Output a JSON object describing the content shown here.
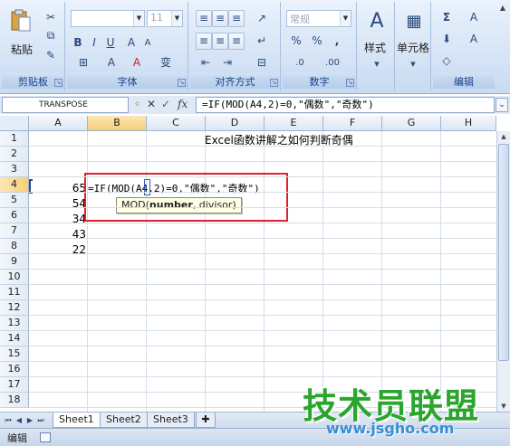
{
  "ribbon": {
    "clipboard": {
      "paste_label": "粘贴",
      "group_label": "剪贴板"
    },
    "font": {
      "font_name": "",
      "font_size": "11",
      "bold": "B",
      "italic": "I",
      "underline": "U",
      "font_color": "A",
      "fill_color": "A",
      "phonetic": "变",
      "grow_font": "A",
      "shrink_font": "A",
      "group_label": "字体"
    },
    "alignment": {
      "group_label": "对齐方式"
    },
    "number": {
      "format": "常规",
      "currency": "%",
      "percent": "%",
      "comma": ",",
      "increase_decimal": ".0",
      "decrease_decimal": ".00",
      "group_label": "数字"
    },
    "styles": {
      "label": "样式"
    },
    "cells": {
      "label": "单元格"
    },
    "editing": {
      "sum": "Σ",
      "sort": "A",
      "find": "A",
      "group_label": "编辑"
    }
  },
  "formula_bar": {
    "name_box": "TRANSPOSE",
    "cancel": "✕",
    "enter": "✓",
    "fx": "fx",
    "content": "=IF(MOD(A4,2)=0,\"偶数\",\"奇数\")"
  },
  "grid": {
    "columns": [
      "A",
      "B",
      "C",
      "D",
      "E",
      "F",
      "G",
      "H"
    ],
    "active_column": "B",
    "rows": [
      "1",
      "2",
      "3",
      "4",
      "5",
      "6",
      "7",
      "8",
      "9",
      "10",
      "11",
      "12",
      "13",
      "14",
      "15",
      "16",
      "17",
      "18"
    ],
    "active_row": "4",
    "title_cell": "Excel函数讲解之如何判断奇偶",
    "a_values": [
      "65",
      "54",
      "34",
      "43",
      "22"
    ],
    "editing_formula": "=IF(MOD(A4,2)=0,\"偶数\",\"奇数\")",
    "tooltip": {
      "func": "MOD(",
      "arg1": "number",
      "rest": ", divisor)"
    }
  },
  "sheets": {
    "tabs": [
      "Sheet1",
      "Sheet2",
      "Sheet3"
    ],
    "active": "Sheet1"
  },
  "status": {
    "mode": "编辑"
  },
  "watermark": {
    "text": "技术员联盟",
    "url": "www.jsgho.com"
  },
  "colors": {
    "accent": "#15428b",
    "highlight_box": "#e0212b",
    "watermark_green": "#2aa52e"
  }
}
